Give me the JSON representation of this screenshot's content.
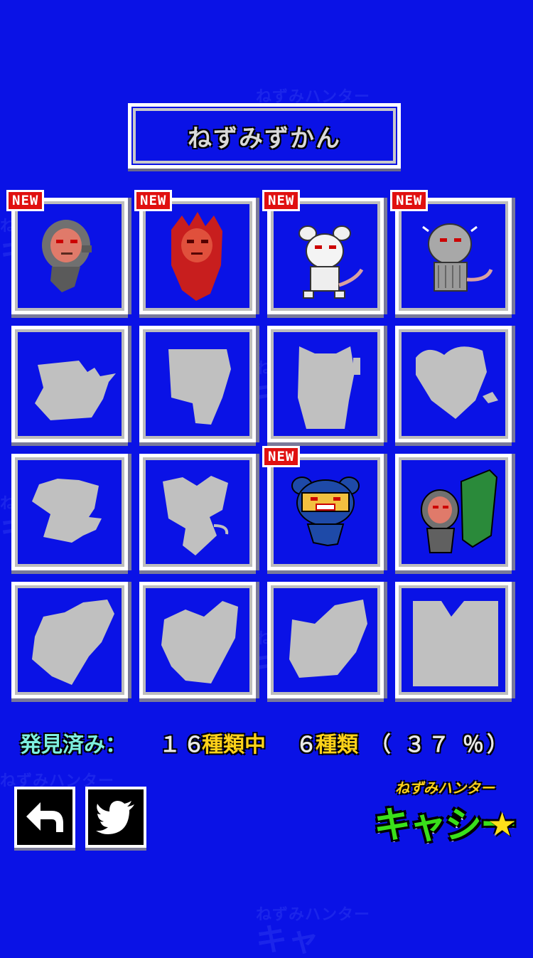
{
  "title": "ねずみずかん",
  "new_label": "NEW",
  "watermark": "ねずみハンター",
  "cells": [
    {
      "state": "found",
      "new": true,
      "icon": "grey-hooded-rat-icon"
    },
    {
      "state": "found",
      "new": true,
      "icon": "red-flame-rat-icon"
    },
    {
      "state": "found",
      "new": true,
      "icon": "white-rat-icon"
    },
    {
      "state": "found",
      "new": true,
      "icon": "grey-striped-rat-icon"
    },
    {
      "state": "locked",
      "new": false,
      "icon": "silhouette-icon"
    },
    {
      "state": "locked",
      "new": false,
      "icon": "silhouette-icon"
    },
    {
      "state": "locked",
      "new": false,
      "icon": "silhouette-icon"
    },
    {
      "state": "locked",
      "new": false,
      "icon": "silhouette-icon"
    },
    {
      "state": "locked",
      "new": false,
      "icon": "silhouette-icon"
    },
    {
      "state": "locked",
      "new": false,
      "icon": "silhouette-icon"
    },
    {
      "state": "found",
      "new": true,
      "icon": "blue-helmet-rat-icon"
    },
    {
      "state": "found",
      "new": false,
      "icon": "rat-with-bag-icon"
    },
    {
      "state": "locked",
      "new": false,
      "icon": "silhouette-icon"
    },
    {
      "state": "locked",
      "new": false,
      "icon": "silhouette-icon"
    },
    {
      "state": "locked",
      "new": false,
      "icon": "silhouette-icon"
    },
    {
      "state": "locked",
      "new": false,
      "icon": "silhouette-icon"
    }
  ],
  "status": {
    "label": "発見済み：",
    "total": "１６",
    "total_suffix": "種類中",
    "found": "６",
    "found_suffix": "種類",
    "percent": "（ ３７ ％）"
  },
  "buttons": {
    "back_icon": "back-arrow-icon",
    "twitter_icon": "twitter-bird-icon"
  },
  "logo": {
    "sub": "ねずみハンター",
    "main": "キャシー"
  },
  "colors": {
    "bg": "#0a12e6",
    "silhouette": "#c0c0c0",
    "new_badge": "#e01010"
  }
}
